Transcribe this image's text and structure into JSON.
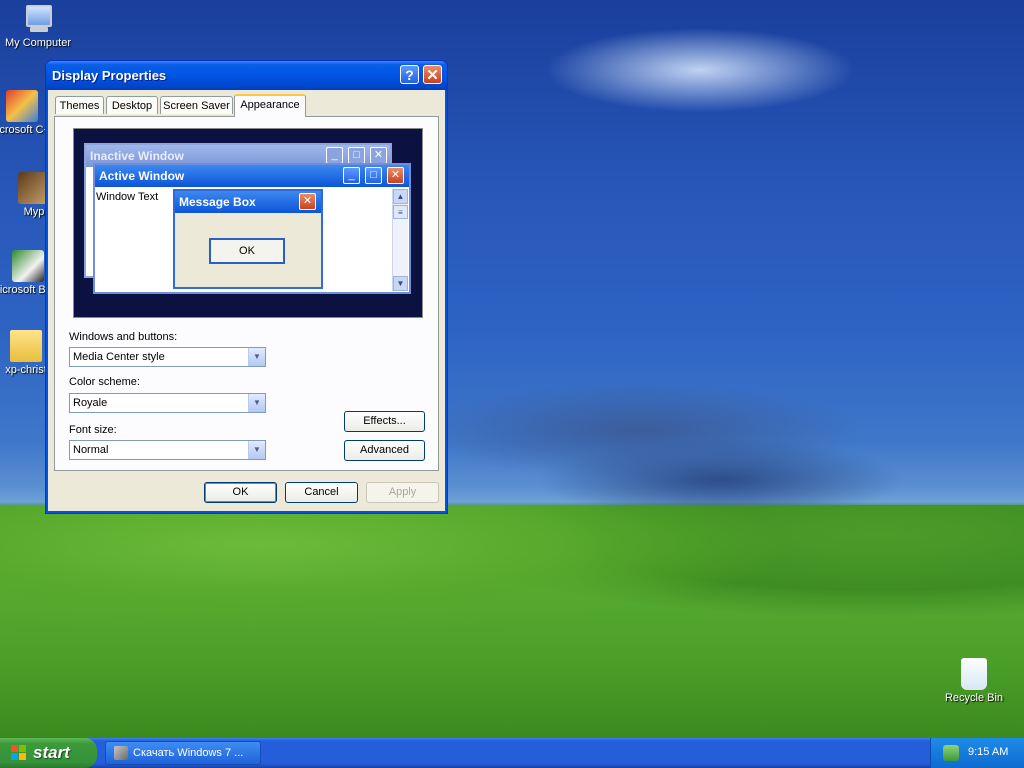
{
  "desktop": {
    "icons": [
      {
        "label": "My Computer"
      },
      {
        "label": "Microsoft C++"
      },
      {
        "label": "Myp"
      },
      {
        "label": "Microsoft Basic"
      },
      {
        "label": "xp-christ"
      },
      {
        "label": "Recycle Bin"
      }
    ]
  },
  "window": {
    "title": "Display Properties",
    "help_label": "?",
    "close_label": "✕",
    "tabs": [
      {
        "label": "Themes"
      },
      {
        "label": "Desktop"
      },
      {
        "label": "Screen Saver"
      },
      {
        "label": "Appearance",
        "active": true
      }
    ],
    "preview": {
      "inactive_title": "Inactive Window",
      "active_title": "Active Window",
      "window_text": "Window Text",
      "message_title": "Message Box",
      "message_ok": "OK"
    },
    "form": {
      "windows_buttons_label": "Windows and buttons:",
      "windows_buttons_value": "Media Center style",
      "color_scheme_label": "Color scheme:",
      "color_scheme_value": "Royale",
      "font_size_label": "Font size:",
      "font_size_value": "Normal",
      "effects_label": "Effects...",
      "advanced_label": "Advanced"
    },
    "buttons": {
      "ok": "OK",
      "cancel": "Cancel",
      "apply": "Apply"
    }
  },
  "taskbar": {
    "start_label": "start",
    "task_label": "Скачать Windows 7 ...",
    "clock": "9:15 AM"
  },
  "colors": {
    "titlebar": "#0054e3",
    "start": "#3c9a3a",
    "taskbar": "#245edb"
  }
}
